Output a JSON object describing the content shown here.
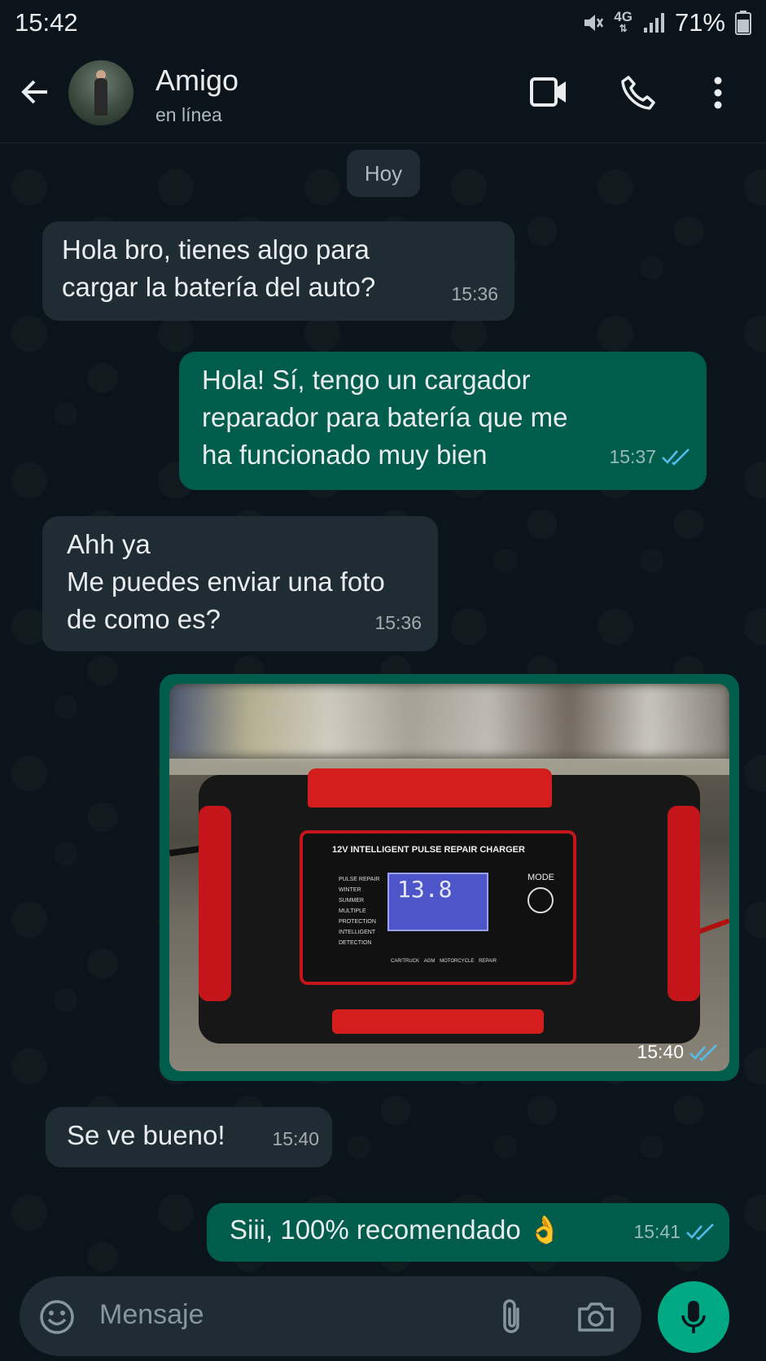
{
  "status_bar": {
    "time": "15:42",
    "network": "4G",
    "battery": "71%",
    "icons": [
      "mute-icon",
      "signal-icon",
      "battery-icon"
    ]
  },
  "header": {
    "contact_name": "Amigo",
    "contact_status": "en línea",
    "icons": [
      "back-arrow-icon",
      "avatar",
      "video-call-icon",
      "phone-icon",
      "more-vert-icon"
    ]
  },
  "date_separator": "Hoy",
  "messages": [
    {
      "direction": "in",
      "lines": [
        "Hola bro, tienes algo para",
        "cargar la batería del auto?"
      ],
      "time": "15:36"
    },
    {
      "direction": "out",
      "lines": [
        "Hola! Sí, tengo un cargador",
        "reparador para batería que me",
        "ha funcionado muy bien"
      ],
      "time": "15:37",
      "read": true
    },
    {
      "direction": "in",
      "lines": [
        "Ahh ya",
        "Me puedes enviar una foto",
        "de como es?"
      ],
      "time": "15:36"
    },
    {
      "direction": "out",
      "type": "image",
      "time": "15:40",
      "read": true,
      "image_text": {
        "title": "12V INTELLIGENT PULSE REPAIR CHARGER",
        "display": "13.8",
        "mode": "MODE",
        "left_labels": [
          "PULSE REPAIR",
          "WINTER SUMMER",
          "MULTIPLE PROTECTION",
          "INTELLIGENT DETECTION"
        ],
        "bottom_labels": [
          "CAR/TRUCK",
          "AGM",
          "MOTORCYCLE",
          "REPAIR"
        ]
      }
    },
    {
      "direction": "in",
      "lines": [
        "Se ve bueno!"
      ],
      "time": "15:40"
    },
    {
      "direction": "out",
      "lines": [
        "Siii, 100% recomendado 👌"
      ],
      "time": "15:41",
      "read": true
    }
  ],
  "composer": {
    "placeholder": "Mensaje",
    "icons": [
      "emoji-icon",
      "attach-icon",
      "camera-icon",
      "mic-icon"
    ]
  },
  "colors": {
    "background": "#0b141a",
    "incoming": "#202c33",
    "outgoing": "#005c4b",
    "accent": "#00a884",
    "read_tick": "#53bdeb"
  }
}
